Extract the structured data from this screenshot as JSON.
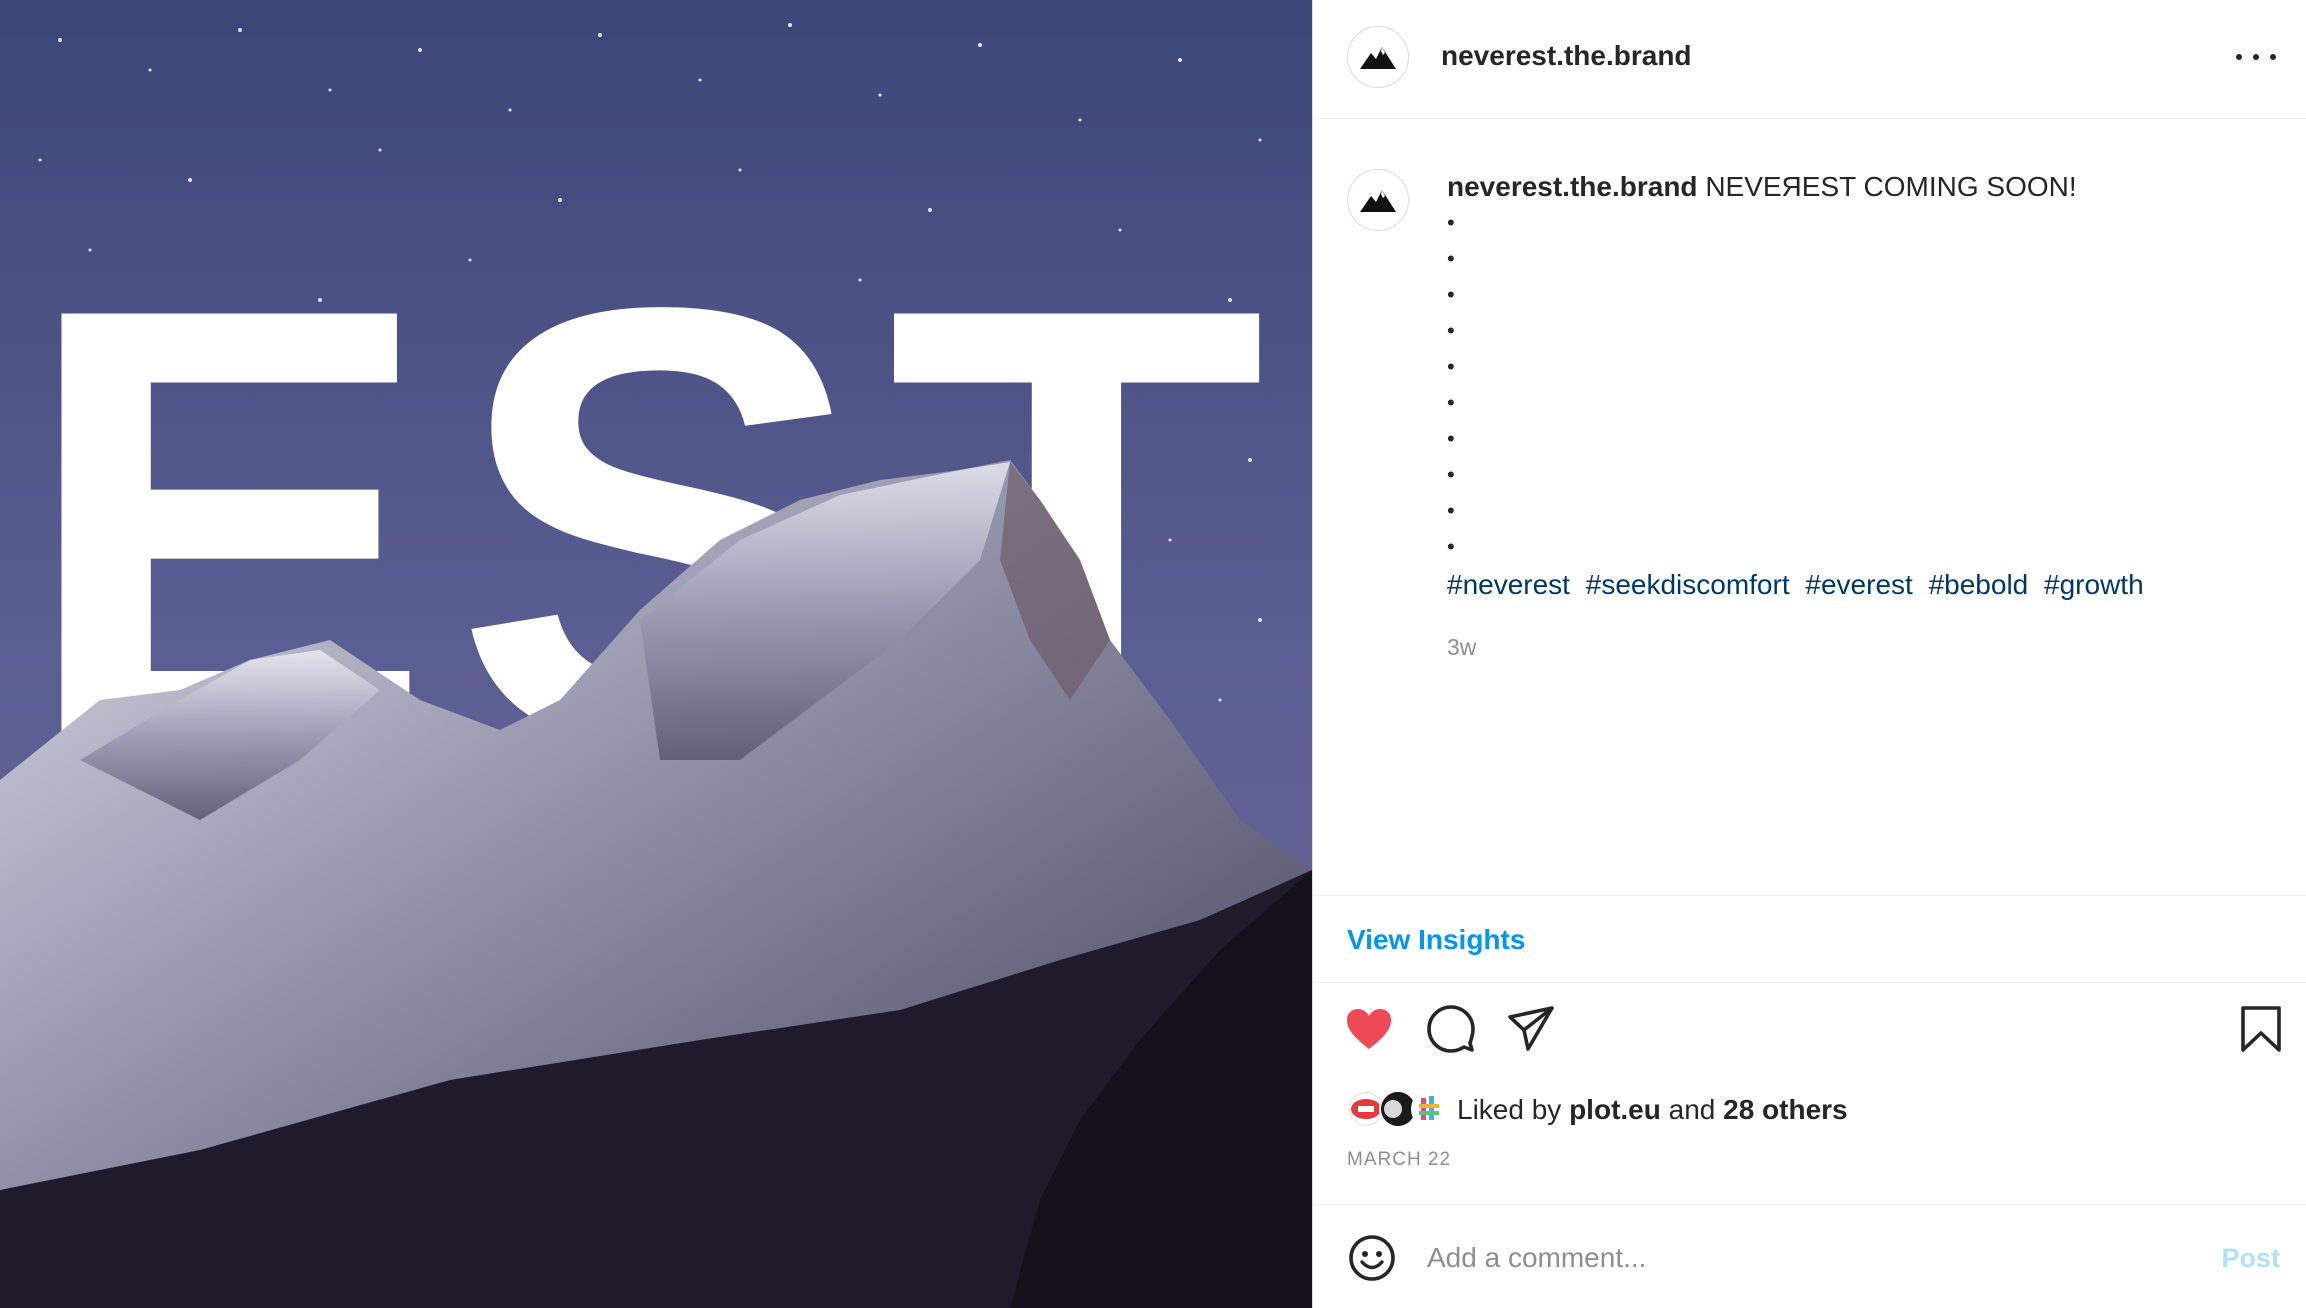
{
  "post": {
    "image_text": "EST"
  },
  "header": {
    "username": "neverest.the.brand",
    "more_icon": "more-horizontal-icon"
  },
  "caption": {
    "username": "neverest.the.brand",
    "text": "NEVEЯEST COMING SOON!",
    "dots": [
      "•",
      "•",
      "•",
      "•",
      "•",
      "•",
      "•",
      "•",
      "•",
      "•"
    ],
    "hashtags": [
      "#neverest",
      "#seekdiscomfort",
      "#everest",
      "#bebold",
      "#growth"
    ],
    "time_ago": "3w"
  },
  "insights": {
    "label": "View Insights"
  },
  "actions": {
    "like_icon": "heart-filled-icon",
    "comment_icon": "comment-icon",
    "share_icon": "paper-plane-icon",
    "save_icon": "bookmark-icon",
    "like_color": "#ed4956"
  },
  "likes": {
    "prefix": "Liked by ",
    "first_user": "plot.eu",
    "middle": " and ",
    "others": "28 others"
  },
  "date": "MARCH 22",
  "comment": {
    "placeholder": "Add a comment...",
    "post_label": "Post"
  },
  "colors": {
    "link_blue": "#0095f6",
    "hashtag": "#00376b",
    "post_disabled": "#b2dffc"
  }
}
